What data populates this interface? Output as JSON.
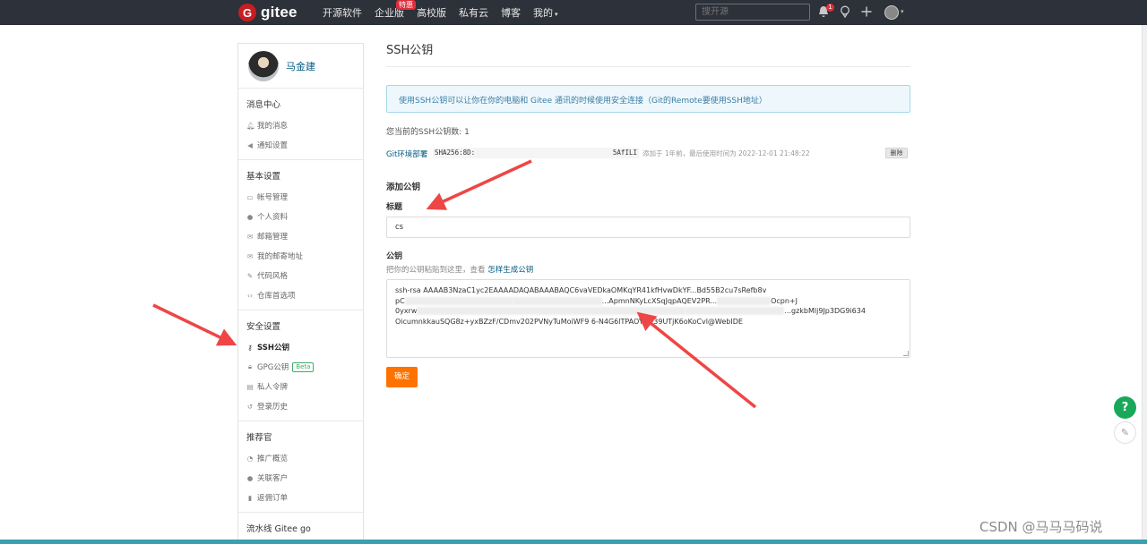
{
  "nav": {
    "logo_text": "gitee",
    "items": [
      {
        "label": "开源软件"
      },
      {
        "label": "企业版",
        "badge": "特惠"
      },
      {
        "label": "高校版"
      },
      {
        "label": "私有云"
      },
      {
        "label": "博客"
      },
      {
        "label": "我的",
        "caret": "▾"
      }
    ],
    "search_placeholder": "搜开源",
    "notification_count": "1"
  },
  "sidebar": {
    "username": "马金建",
    "sections": [
      {
        "title": "消息中心",
        "items": [
          {
            "icon": "bell-icon",
            "label": "我的消息"
          },
          {
            "icon": "speaker-icon",
            "label": "通知设置"
          }
        ]
      },
      {
        "title": "基本设置",
        "items": [
          {
            "icon": "id-card-icon",
            "label": "帐号管理"
          },
          {
            "icon": "user-icon",
            "label": "个人资料"
          },
          {
            "icon": "envelope-icon",
            "label": "邮箱管理"
          },
          {
            "icon": "envelope-icon",
            "label": "我的邮寄地址"
          },
          {
            "icon": "brush-icon",
            "label": "代码风格"
          },
          {
            "icon": "code-icon",
            "label": "仓库首选项"
          }
        ]
      },
      {
        "title": "安全设置",
        "items": [
          {
            "icon": "key-icon",
            "label": "SSH公钥",
            "active": true
          },
          {
            "icon": "lock-icon",
            "label": "GPG公钥",
            "badge": "Beta"
          },
          {
            "icon": "token-icon",
            "label": "私人令牌"
          },
          {
            "icon": "history-icon",
            "label": "登录历史"
          }
        ]
      },
      {
        "title": "推荐官",
        "items": [
          {
            "icon": "chart-icon",
            "label": "推广概览"
          },
          {
            "icon": "user-link-icon",
            "label": "关联客户"
          },
          {
            "icon": "receipt-icon",
            "label": "返佣订单"
          }
        ]
      },
      {
        "title": "流水线 Gitee go",
        "items": []
      }
    ]
  },
  "main": {
    "title": "SSH公钥",
    "info": "使用SSH公钥可以让你在你的电脑和 Gitee 通讯的时候使用安全连接（Git的Remote要使用SSH地址）",
    "count_text": "您当前的SSH公钥数: 1",
    "key": {
      "name": "Git环境部署",
      "fingerprint_left": "SHA256:8D:",
      "fingerprint_right": "5AfILI",
      "meta": "添加于 1年前，最后使用时间为 2022-12-01 21:48:22",
      "delete_label": "删除"
    },
    "add_title": "添加公钥",
    "title_label": "标题",
    "title_value": "cs",
    "pubkey_label": "公钥",
    "pubkey_hint": "把你的公钥粘贴到这里，查看",
    "pubkey_hint_link": "怎样生成公钥",
    "pubkey_line1": "ssh-rsa AAAAB3NzaC1yc2EAAAADAQABAAABAQC6vaVEDkaOMKqYR41kfHvwDkYF...",
    "pubkey_line1_end": "Bd55B2cu7sRefb8v",
    "pubkey_line2_start": "pC",
    "pubkey_line2_end": "...ApmnNKyLcXSqJqpAQEV2PR...",
    "pubkey_line2_tail": "Ocpn+J",
    "pubkey_line3_start": "0yxrw",
    "pubkey_line3_tail": "...gzkbMlj9Jp3DG9i634",
    "pubkey_line4": "OicumnkkauSQG8z+yxBZzF/CDmv202PVNyTuMoiWF9 6-N4G6lTPAOYPik39UTjK6oKoCvl@WebIDE",
    "submit_label": "确定"
  },
  "floating": {
    "help": "?",
    "edit": "✎"
  },
  "watermark": "CSDN @马马马码说"
}
